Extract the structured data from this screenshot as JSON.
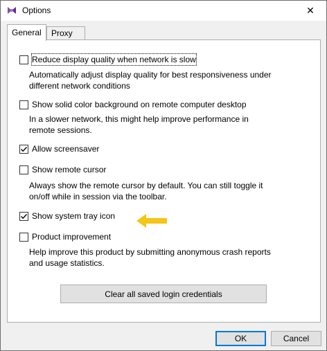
{
  "window": {
    "title": "Options",
    "close_symbol": "✕",
    "app_icon": "app-logo-icon"
  },
  "tabs": [
    {
      "label": "General",
      "active": true
    },
    {
      "label": "Proxy",
      "active": false
    }
  ],
  "options": [
    {
      "label": "Reduce display quality when network is slow",
      "checked": false,
      "focused": true,
      "description_lines": [
        "Automatically adjust display quality for best responsiveness under",
        "different network conditions"
      ]
    },
    {
      "label": "Show solid color background on remote computer desktop",
      "checked": false,
      "description_lines": [
        "In a slower network, this might help improve performance in",
        "remote sessions."
      ]
    },
    {
      "label": "Allow screensaver",
      "checked": true
    },
    {
      "label": "Show remote cursor",
      "checked": false,
      "description_lines": [
        "Always show the remote cursor by default. You can still toggle it",
        "on/off while in session via the toolbar."
      ]
    },
    {
      "label": "Show system tray icon",
      "checked": true
    },
    {
      "label": "Product improvement",
      "checked": false,
      "description_lines": [
        "Help improve this product by submitting anonymous crash reports",
        "and usage statistics."
      ]
    }
  ],
  "clear_credentials_label": "Clear all saved login credentials",
  "footer": {
    "ok_label": "OK",
    "cancel_label": "Cancel"
  },
  "colors": {
    "arrow": "#f5c518",
    "accent": "#0078d7"
  }
}
